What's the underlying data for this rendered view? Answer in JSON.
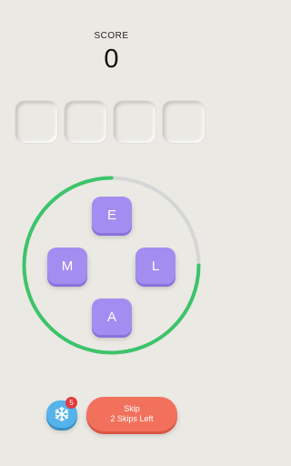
{
  "score": {
    "label": "SCORE",
    "value": "0"
  },
  "answer_slots": [
    "",
    "",
    "",
    ""
  ],
  "timer": {
    "fraction_remaining": 0.75,
    "color": "#3cc46a",
    "track_color": "#d6d6d6"
  },
  "tiles": {
    "top": "E",
    "left": "M",
    "right": "L",
    "bottom": "A",
    "color": "#a48df0"
  },
  "freeze": {
    "icon": "snowflake-icon",
    "count": "5",
    "color": "#55b3ec",
    "badge_color": "#e23a3a"
  },
  "skip": {
    "line1": "Skip",
    "line2": "2 Skips Left",
    "color": "#f2715d"
  }
}
